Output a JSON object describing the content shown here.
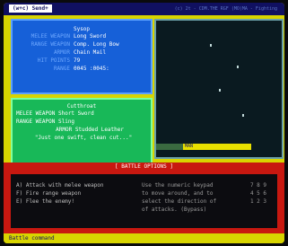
{
  "window": {
    "title": "(w+c) Send+",
    "header_text": "(c)   2t  - CDM.THE  RGF  (MO)MA - Fighting"
  },
  "player": {
    "name": "Sysop",
    "stats": [
      {
        "label": "MELEE WEAPON",
        "value": "Long Sword"
      },
      {
        "label": "RANGE WEAPON",
        "value": "Comp. Long Bow"
      },
      {
        "label": "ARMOR",
        "value": "Chain Mail"
      },
      {
        "label": "HIT POINTS",
        "value": "79"
      },
      {
        "label": "RANGE",
        "value": "0045 :0045:"
      }
    ]
  },
  "enemy": {
    "name": "Cutthroat",
    "melee_label": "MELEE WEAPON",
    "melee_value": "Short Sword",
    "range_label": "RANGE WEAPON",
    "range_value": "Sling",
    "armor_label": "ARMOR",
    "armor_value": "Studded Leather",
    "quote": "\"Just one swift, clean cut...\""
  },
  "map": {
    "status_text": "MAN"
  },
  "battle": {
    "divider_label": "[ BATTLE OPTIONS ]",
    "commands": [
      "A) Attack with melee weapon",
      "F) Fire range weapon",
      "E) Flee the enemy!"
    ],
    "help_lines": [
      "Use the numeric keypad",
      "to move around, and to",
      "select the direction of",
      "of attacks. (Bypass)"
    ],
    "key_lines": [
      "7 8 9",
      "4 5 6",
      "1 2 3"
    ]
  },
  "prompt": {
    "label": "Battle command"
  },
  "colors": {
    "screen_bg": "#d8d400",
    "player_panel": "#1660d8",
    "enemy_panel": "#18b858",
    "battle_bar": "#c81810",
    "map_bg": "#0a1a20"
  }
}
